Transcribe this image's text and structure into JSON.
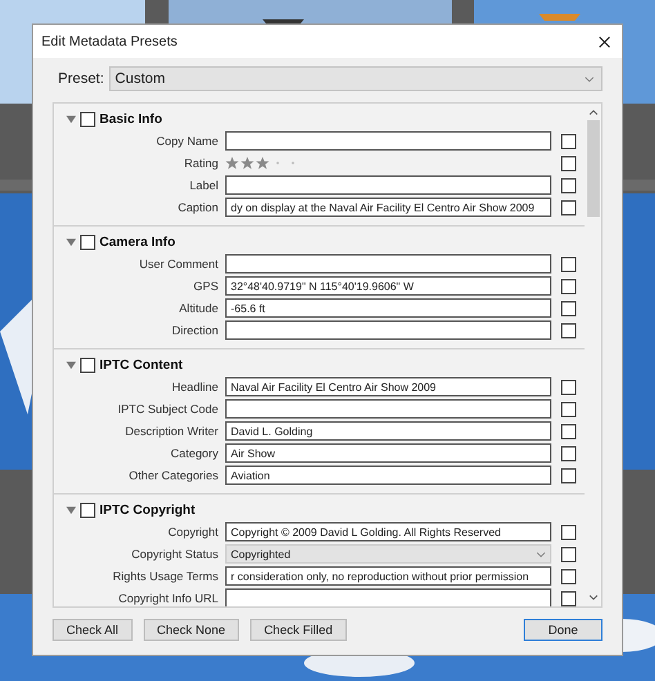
{
  "dialog": {
    "title": "Edit Metadata Presets",
    "preset_label": "Preset:",
    "preset_value": "Custom"
  },
  "sections": [
    {
      "title": "Basic Info",
      "expanded": true,
      "checked": false,
      "rows": [
        {
          "kind": "text",
          "label": "Copy Name",
          "value": "",
          "checked": false
        },
        {
          "kind": "stars",
          "label": "Rating",
          "stars": 3,
          "checked": false
        },
        {
          "kind": "text",
          "label": "Label",
          "value": "",
          "checked": false
        },
        {
          "kind": "text",
          "label": "Caption",
          "value": "dy on display at the Naval Air Facility El Centro Air Show 2009",
          "checked": false
        }
      ]
    },
    {
      "title": "Camera Info",
      "expanded": true,
      "checked": false,
      "rows": [
        {
          "kind": "text",
          "label": "User Comment",
          "value": "",
          "checked": false
        },
        {
          "kind": "text",
          "label": "GPS",
          "value": "32°48'40.9719\" N 115°40'19.9606\" W",
          "checked": false
        },
        {
          "kind": "text",
          "label": "Altitude",
          "value": "-65.6 ft",
          "checked": false
        },
        {
          "kind": "text",
          "label": "Direction",
          "value": "",
          "checked": false
        }
      ]
    },
    {
      "title": "IPTC Content",
      "expanded": true,
      "checked": false,
      "rows": [
        {
          "kind": "text",
          "label": "Headline",
          "value": "Naval Air Facility El Centro Air Show 2009",
          "checked": false
        },
        {
          "kind": "text",
          "label": "IPTC Subject Code",
          "value": "",
          "checked": false
        },
        {
          "kind": "text",
          "label": "Description Writer",
          "value": "David L. Golding",
          "checked": false
        },
        {
          "kind": "text",
          "label": "Category",
          "value": "Air Show",
          "checked": false
        },
        {
          "kind": "text",
          "label": "Other Categories",
          "value": "Aviation",
          "checked": false
        }
      ]
    },
    {
      "title": "IPTC Copyright",
      "expanded": true,
      "checked": false,
      "rows": [
        {
          "kind": "text",
          "label": "Copyright",
          "value": "Copyright © 2009 David L Golding. All Rights Reserved",
          "checked": false
        },
        {
          "kind": "select",
          "label": "Copyright Status",
          "value": "Copyrighted",
          "checked": false
        },
        {
          "kind": "text",
          "label": "Rights Usage Terms",
          "value": "r consideration only, no reproduction without prior permission",
          "checked": false
        },
        {
          "kind": "text",
          "label": "Copyright Info URL",
          "value": "",
          "checked": false
        }
      ]
    }
  ],
  "buttons": [
    {
      "label": "Check All",
      "default": false
    },
    {
      "label": "Check None",
      "default": false
    },
    {
      "label": "Check Filled",
      "default": false
    },
    {
      "label": "Done",
      "default": true
    }
  ]
}
